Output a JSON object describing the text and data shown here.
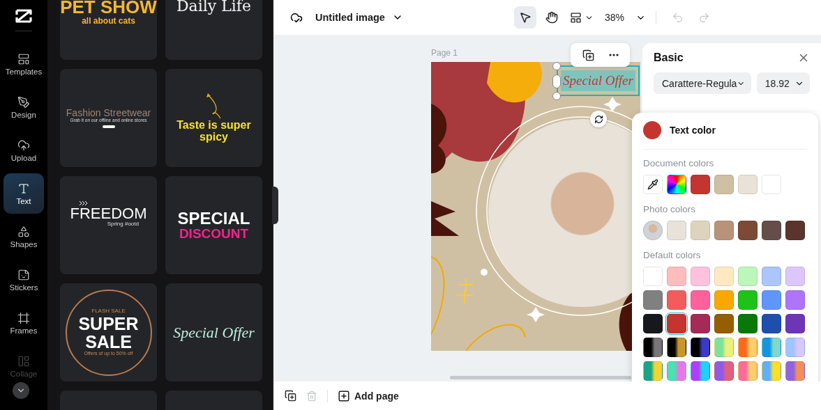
{
  "nav": {
    "items": [
      {
        "label": "Templates",
        "selected": false
      },
      {
        "label": "Design",
        "selected": false
      },
      {
        "label": "Upload",
        "selected": false
      },
      {
        "label": "Text",
        "selected": true
      },
      {
        "label": "Shapes",
        "selected": false
      },
      {
        "label": "Stickers",
        "selected": false
      },
      {
        "label": "Frames",
        "selected": false
      },
      {
        "label": "Collage",
        "selected": false
      }
    ]
  },
  "templates": [
    {
      "kind": "pet-show",
      "lines": [
        "PET SHOW",
        "all about cats"
      ]
    },
    {
      "kind": "daily-life",
      "lines": [
        "Daily Life"
      ]
    },
    {
      "kind": "fashion",
      "lines": [
        "Fashion Streetwear",
        "Grab it on our offline and online stores"
      ]
    },
    {
      "kind": "spicy",
      "lines": [
        "Taste is super spicy"
      ]
    },
    {
      "kind": "freedom",
      "lines": [
        "FREEDOM",
        "Spring #ootd"
      ]
    },
    {
      "kind": "discount",
      "lines": [
        "SPECIAL",
        "DISCOUNT"
      ]
    },
    {
      "kind": "super-sale",
      "lines": [
        "FLASH SALE",
        "SUPER",
        "SALE",
        "Offers of up to 50% off"
      ]
    },
    {
      "kind": "special-offer",
      "lines": [
        "Special Offer"
      ]
    },
    {
      "kind": "blank"
    },
    {
      "kind": "blank"
    }
  ],
  "topbar": {
    "title": "Untitled image",
    "zoom": "38%",
    "undo_disabled": true,
    "redo_disabled": true
  },
  "canvas": {
    "page_label": "Page 1",
    "selected_text": "Special Offer"
  },
  "panel": {
    "title": "Basic",
    "font": "Carattere-Regula",
    "size": "18.92"
  },
  "text_color": {
    "title": "Text color",
    "color": "#c4352f",
    "sections": [
      {
        "title": "Document colors",
        "swatches": [
          {
            "kind": "eyedropper"
          },
          {
            "kind": "spectrum"
          },
          {
            "kind": "color",
            "color": "#c4352f"
          },
          {
            "kind": "color",
            "color": "#cfc0a3"
          },
          {
            "kind": "color",
            "color": "#e9e2d6"
          },
          {
            "kind": "color",
            "color": "#ffffff"
          }
        ]
      },
      {
        "title": "Photo colors",
        "swatches": [
          {
            "kind": "photo"
          },
          {
            "kind": "color",
            "color": "#e9e2da"
          },
          {
            "kind": "color",
            "color": "#ddd4bd"
          },
          {
            "kind": "color",
            "color": "#b9927a"
          },
          {
            "kind": "color",
            "color": "#7c4a36"
          },
          {
            "kind": "color",
            "color": "#654e4a"
          },
          {
            "kind": "color",
            "color": "#5a342d"
          }
        ]
      },
      {
        "title": "Default colors",
        "swatches": [
          {
            "kind": "color",
            "color": "#ffffff",
            "selected": false
          },
          {
            "kind": "color",
            "color": "#ffbcbc",
            "selected": false
          },
          {
            "kind": "color",
            "color": "#ffc1dc",
            "selected": false
          },
          {
            "kind": "color",
            "color": "#ffe9c0",
            "selected": false
          },
          {
            "kind": "color",
            "color": "#bbf7b8",
            "selected": false
          },
          {
            "kind": "color",
            "color": "#aac6fc",
            "selected": false
          },
          {
            "kind": "color",
            "color": "#dcc6fb",
            "selected": false
          },
          {
            "kind": "color",
            "color": "#808080",
            "selected": false
          },
          {
            "kind": "color",
            "color": "#f25c5a",
            "selected": false
          },
          {
            "kind": "color",
            "color": "#ff619d",
            "selected": false
          },
          {
            "kind": "color",
            "color": "#f8a800",
            "selected": false
          },
          {
            "kind": "color",
            "color": "#20c118",
            "selected": false
          },
          {
            "kind": "color",
            "color": "#5f95fd",
            "selected": false
          },
          {
            "kind": "color",
            "color": "#ae74fb",
            "selected": false
          },
          {
            "kind": "color",
            "color": "#16181d",
            "selected": false
          },
          {
            "kind": "color",
            "color": "#c4352f",
            "selected": true
          },
          {
            "kind": "color",
            "color": "#a52a57",
            "selected": false
          },
          {
            "kind": "color",
            "color": "#935f00",
            "selected": false
          },
          {
            "kind": "color",
            "color": "#087808",
            "selected": false
          },
          {
            "kind": "color",
            "color": "#1f4fae",
            "selected": false
          },
          {
            "kind": "color",
            "color": "#6d35b8",
            "selected": false
          },
          {
            "kind": "gradient",
            "stops": [
              {
                "color": "#000000"
              },
              {
                "color": "#777777"
              }
            ],
            "selected": false
          },
          {
            "kind": "gradient",
            "stops": [
              {
                "color": "#000000"
              },
              {
                "color": "#c8962b"
              }
            ],
            "selected": false
          },
          {
            "kind": "gradient",
            "stops": [
              {
                "color": "#000000"
              },
              {
                "color": "#3a3ac6"
              }
            ],
            "selected": false
          },
          {
            "kind": "gradient",
            "stops": [
              {
                "color": "#7de39a"
              },
              {
                "color": "#ebf07a"
              }
            ],
            "selected": false
          },
          {
            "kind": "gradient",
            "stops": [
              {
                "color": "#ff6a1a"
              },
              {
                "color": "#ffd06a"
              }
            ],
            "selected": false
          },
          {
            "kind": "gradient",
            "stops": [
              {
                "color": "#1196e6"
              },
              {
                "color": "#7fd9c9"
              }
            ],
            "selected": false
          },
          {
            "kind": "gradient",
            "stops": [
              {
                "color": "#9ec5ff"
              },
              {
                "color": "#d8c6ff"
              }
            ],
            "selected": false
          },
          {
            "kind": "gradient",
            "stops": [
              {
                "color": "#1aa385"
              },
              {
                "color": "#f4d432"
              }
            ],
            "selected": false
          },
          {
            "kind": "gradient",
            "stops": [
              {
                "color": "#4de0b2"
              },
              {
                "color": "#e47ae9"
              }
            ],
            "selected": false
          },
          {
            "kind": "gradient",
            "stops": [
              {
                "color": "#b23cff"
              },
              {
                "color": "#1fd1ff"
              }
            ],
            "selected": false
          },
          {
            "kind": "gradient",
            "stops": [
              {
                "color": "#8f5ae6"
              },
              {
                "color": "#e06080"
              }
            ],
            "selected": false
          },
          {
            "kind": "gradient",
            "stops": [
              {
                "color": "#ff6a9a"
              },
              {
                "color": "#ffce6a"
              }
            ],
            "selected": false
          },
          {
            "kind": "gradient",
            "stops": [
              {
                "color": "#5fb0ff"
              },
              {
                "color": "#ffe020"
              }
            ],
            "selected": false
          },
          {
            "kind": "gradient",
            "stops": [
              {
                "color": "#9062e4"
              },
              {
                "color": "#f09058"
              }
            ],
            "selected": false
          }
        ]
      }
    ]
  },
  "bottombar": {
    "add_page": "Add page",
    "delete_disabled": true
  }
}
